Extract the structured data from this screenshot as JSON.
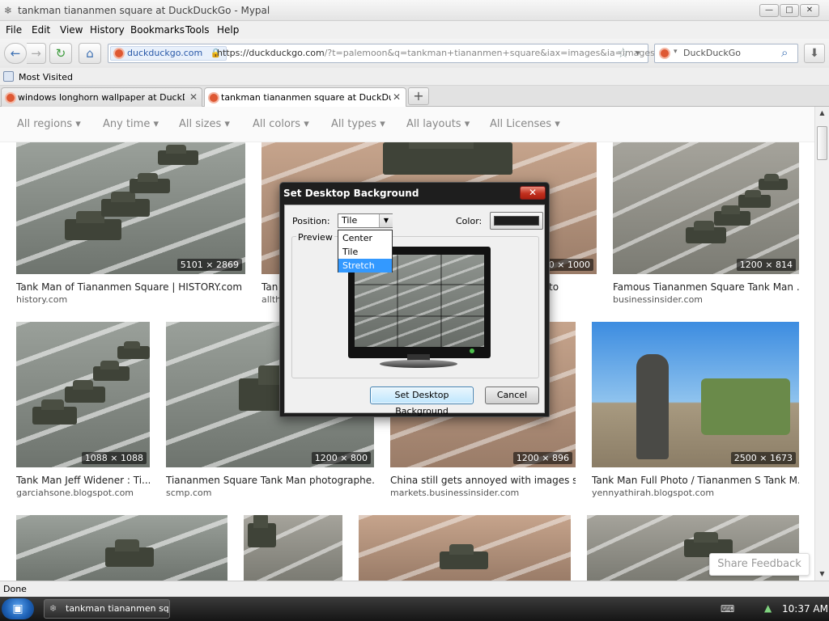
{
  "window": {
    "title": "tankman tiananmen square at DuckDuckGo - Mypal",
    "min_glyph": "—",
    "max_glyph": "□",
    "close_glyph": "✕"
  },
  "menu": [
    "File",
    "Edit",
    "View",
    "History",
    "Bookmarks",
    "Tools",
    "Help"
  ],
  "nav": {
    "site_identity": "duckduckgo.com",
    "url_prefix": "https://duckduckgo.com",
    "url_rest": "/?t=palemoon&q=tankman+tiananmen+square&iax=images&ia=images",
    "search_engine": "DuckDuckGo",
    "back_icon": "←",
    "forward_icon": "→",
    "reload_icon": "↻",
    "home_icon": "⌂",
    "star_icon": "☆",
    "dropdown_icon": "▾",
    "search_icon": "⌕",
    "download_icon": "⬇"
  },
  "bookmarks": {
    "most_visited": "Most Visited"
  },
  "tabs": [
    {
      "label": "windows longhorn wallpaper at DuckDuck...",
      "active": false
    },
    {
      "label": "tankman tiananmen square at DuckDuckGo",
      "active": true
    }
  ],
  "newtab_glyph": "+",
  "filters": [
    "All regions",
    "Any time",
    "All sizes",
    "All colors",
    "All types",
    "All layouts",
    "All Licenses"
  ],
  "filter_arrow": "▾",
  "results": [
    {
      "title": "Tank Man of Tiananmen Square | HISTORY.com ...",
      "source": "history.com",
      "dims": "5101 × 2869"
    },
    {
      "title": "Tan",
      "source": "allth",
      "dims": "500 × 1000"
    },
    {
      "title": "to",
      "source": "",
      "dims": ""
    },
    {
      "title": "Famous Tiananmen Square Tank Man ...",
      "source": "businessinsider.com",
      "dims": "1200 × 814"
    },
    {
      "title": "Tank Man Jeff Widener : Ti...",
      "source": "garciahsone.blogspot.com",
      "dims": "1088 × 1088"
    },
    {
      "title": "Tiananmen Square Tank Man photographe...",
      "source": "scmp.com",
      "dims": "1200 × 800"
    },
    {
      "title": "China still gets annoyed with images s...",
      "source": "markets.businessinsider.com",
      "dims": "1200 × 896"
    },
    {
      "title": "Tank Man Full Photo / Tiananmen S Tank M...",
      "source": "yennyathirah.blogspot.com",
      "dims": "2500 × 1673"
    }
  ],
  "share_feedback": "Share Feedback",
  "status": "Done",
  "taskbar": {
    "item": "tankman tiananmen sq...",
    "clock": "10:37 AM"
  },
  "dialog": {
    "title": "Set Desktop Background",
    "position_label": "Position:",
    "position_value": "Tile",
    "position_options": [
      "Center",
      "Tile",
      "Stretch"
    ],
    "highlighted_option": "Stretch",
    "color_label": "Color:",
    "color_value": "#1e1e1e",
    "preview_label": "Preview",
    "set_button": "Set Desktop Background",
    "cancel_button": "Cancel"
  }
}
